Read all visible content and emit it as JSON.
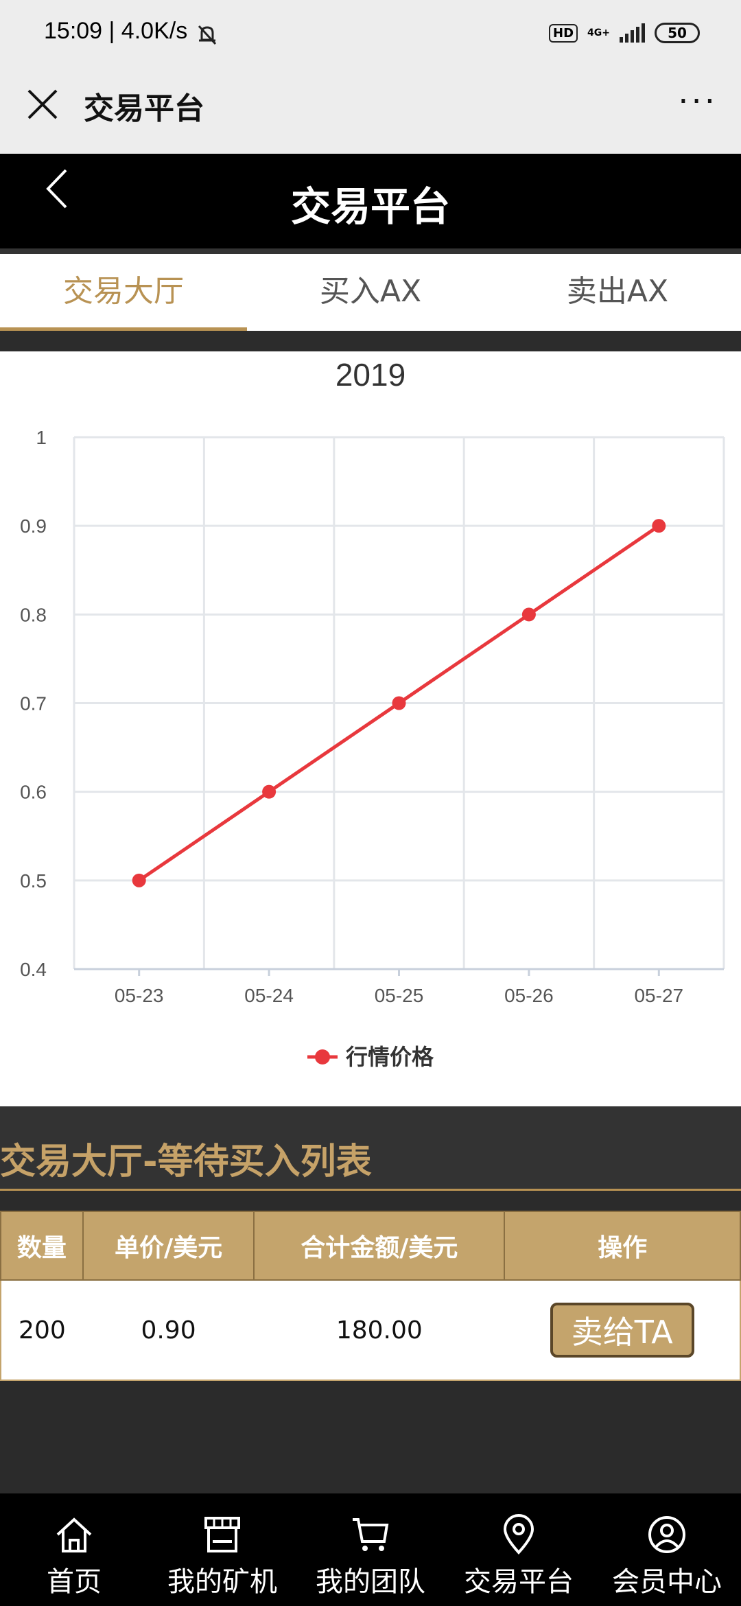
{
  "status_bar": {
    "time": "15:09 | 4.0K/s",
    "hd": "HD",
    "network": "4G+",
    "battery": "50"
  },
  "wechat_header": {
    "title": "交易平台",
    "more": "···"
  },
  "app_header": {
    "title": "交易平台"
  },
  "tabs": [
    {
      "label": "交易大厅",
      "active": true
    },
    {
      "label": "买入AX",
      "active": false
    },
    {
      "label": "卖出AX",
      "active": false
    }
  ],
  "chart_data": {
    "type": "line",
    "title": "2019",
    "categories": [
      "05-23",
      "05-24",
      "05-25",
      "05-26",
      "05-27"
    ],
    "series": [
      {
        "name": "行情价格",
        "values": [
          0.5,
          0.6,
          0.7,
          0.8,
          0.9
        ],
        "color": "#e8383d"
      }
    ],
    "ylim": [
      0.4,
      1
    ],
    "yticks": [
      "0.4",
      "0.5",
      "0.6",
      "0.7",
      "0.8",
      "0.9",
      "1"
    ],
    "grid": true,
    "legend_position": "bottom"
  },
  "list": {
    "title": "交易大厅-等待买入列表",
    "columns": [
      "数量",
      "单价/美元",
      "合计金额/美元",
      "操作"
    ],
    "rows": [
      {
        "qty": "200",
        "price": "0.90",
        "total": "180.00",
        "action": "卖给TA"
      }
    ]
  },
  "bottom_nav": [
    {
      "label": "首页",
      "icon": "home-icon"
    },
    {
      "label": "我的矿机",
      "icon": "store-icon"
    },
    {
      "label": "我的团队",
      "icon": "cart-icon"
    },
    {
      "label": "交易平台",
      "icon": "location-pin-icon"
    },
    {
      "label": "会员中心",
      "icon": "user-icon"
    }
  ]
}
